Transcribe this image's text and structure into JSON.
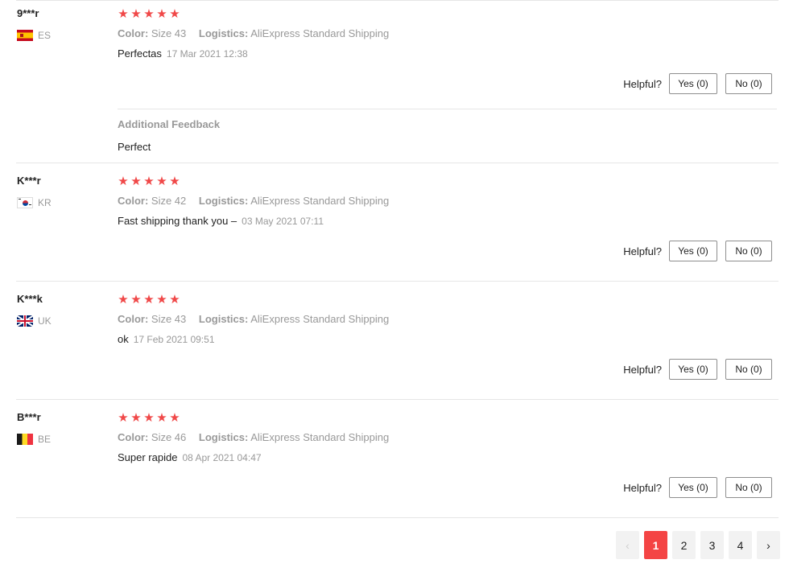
{
  "labels": {
    "color": "Color:",
    "logistics": "Logistics:",
    "helpful": "Helpful?",
    "star": "★"
  },
  "reviews": [
    {
      "user": "9***r",
      "country": "ES",
      "flag": "es-flag-icon",
      "color": "Size 43",
      "logistics": "AliExpress Standard Shipping",
      "comment": "Perfectas",
      "date": "17 Mar 2021 12:38",
      "yes": "Yes (0)",
      "no": "No (0)",
      "additional": {
        "title": "Additional Feedback",
        "text": "Perfect"
      }
    },
    {
      "user": "K***r",
      "country": "KR",
      "flag": "kr-flag-icon",
      "color": "Size 42",
      "logistics": "AliExpress Standard Shipping",
      "comment": "Fast shipping thank you –",
      "date": "03 May 2021 07:11",
      "yes": "Yes (0)",
      "no": "No (0)"
    },
    {
      "user": "K***k",
      "country": "UK",
      "flag": "uk-flag-icon",
      "color": "Size 43",
      "logistics": "AliExpress Standard Shipping",
      "comment": "ok",
      "date": "17 Feb 2021 09:51",
      "yes": "Yes (0)",
      "no": "No (0)"
    },
    {
      "user": "B***r",
      "country": "BE",
      "flag": "be-flag-icon",
      "color": "Size 46",
      "logistics": "AliExpress Standard Shipping",
      "comment": "Super rapide",
      "date": "08 Apr 2021 04:47",
      "yes": "Yes (0)",
      "no": "No (0)"
    }
  ],
  "rating_stars": 5,
  "pagination": {
    "prev": "‹",
    "pages": [
      "1",
      "2",
      "3",
      "4"
    ],
    "active": "1",
    "next": "›"
  },
  "colors": {
    "star": "#f04848",
    "active_page": "#f44444",
    "muted_text": "#999999"
  }
}
